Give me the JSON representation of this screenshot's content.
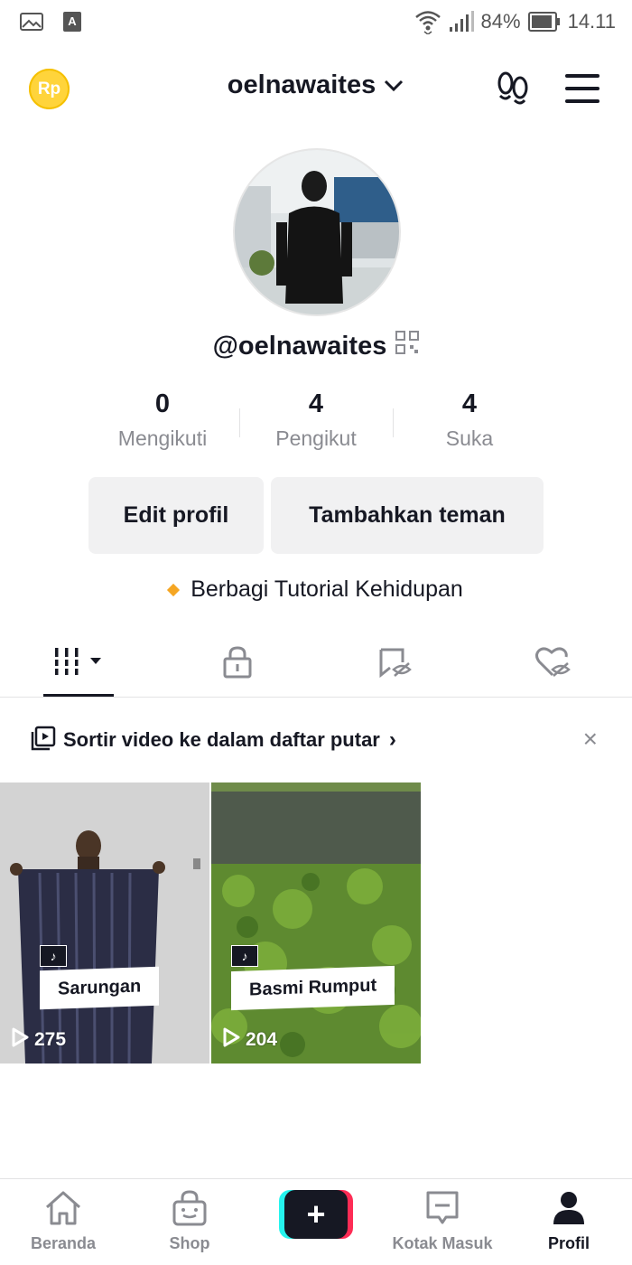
{
  "status_bar": {
    "battery_percent": "84%",
    "time": "14.11"
  },
  "topbar": {
    "coin_label": "Rp",
    "username": "oelnawaites"
  },
  "profile": {
    "handle": "@oelnawaites",
    "stats": [
      {
        "value": "0",
        "label": "Mengikuti"
      },
      {
        "value": "4",
        "label": "Pengikut"
      },
      {
        "value": "4",
        "label": "Suka"
      }
    ],
    "edit_button": "Edit profil",
    "add_friends_button": "Tambahkan teman",
    "bio": "Berbagi Tutorial Kehidupan"
  },
  "tabs": [
    "videos-grid",
    "private",
    "reposts",
    "liked"
  ],
  "playlist_hint": {
    "text": "Sortir video ke dalam daftar putar",
    "chevron": "›",
    "close": "×"
  },
  "videos": [
    {
      "caption": "Sarungan",
      "views": "275",
      "badge": "♪"
    },
    {
      "caption": "Basmi Rumput",
      "views": "204",
      "badge": "♪"
    }
  ],
  "bottom_nav": [
    {
      "label": "Beranda",
      "icon": "home-icon"
    },
    {
      "label": "Shop",
      "icon": "shop-bag-icon"
    },
    {
      "label": "+",
      "icon": "plus-icon"
    },
    {
      "label": "Kotak Masuk",
      "icon": "inbox-icon"
    },
    {
      "label": "Profil",
      "icon": "profile-icon"
    }
  ],
  "colors": {
    "text": "#161823",
    "secondary": "#8a8b91",
    "button_bg": "#f1f1f2",
    "coin": "#ffd43b",
    "accent_cyan": "#25f4ee",
    "accent_pink": "#fe2c55"
  }
}
